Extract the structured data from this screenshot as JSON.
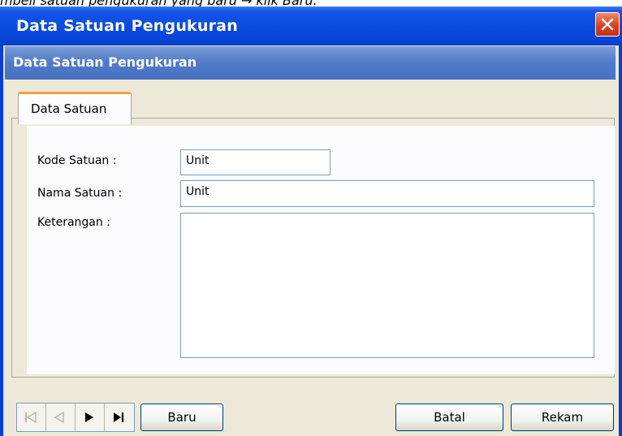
{
  "doc_text": "mbeli satuan pengukuran yang baru → klik Baru.",
  "window": {
    "title": "Data Satuan Pengukuran",
    "header": "Data Satuan Pengukuran"
  },
  "tab": {
    "label": "Data Satuan"
  },
  "form": {
    "kode_label": "Kode Satuan :",
    "kode_value": "Unit",
    "nama_label": "Nama Satuan :",
    "nama_value": "Unit",
    "keterangan_label": "Keterangan :",
    "keterangan_value": ""
  },
  "navigator": {
    "icons": [
      "first-record-icon",
      "prev-record-icon",
      "next-record-icon",
      "last-record-icon"
    ]
  },
  "buttons": {
    "baru": "Baru",
    "batal": "Batal",
    "rekam": "Rekam"
  },
  "colors": {
    "titlebar": "#0a4be3",
    "header_band": "#5079c8",
    "tab_accent": "#f2a23a",
    "close_button": "#d8421e"
  }
}
